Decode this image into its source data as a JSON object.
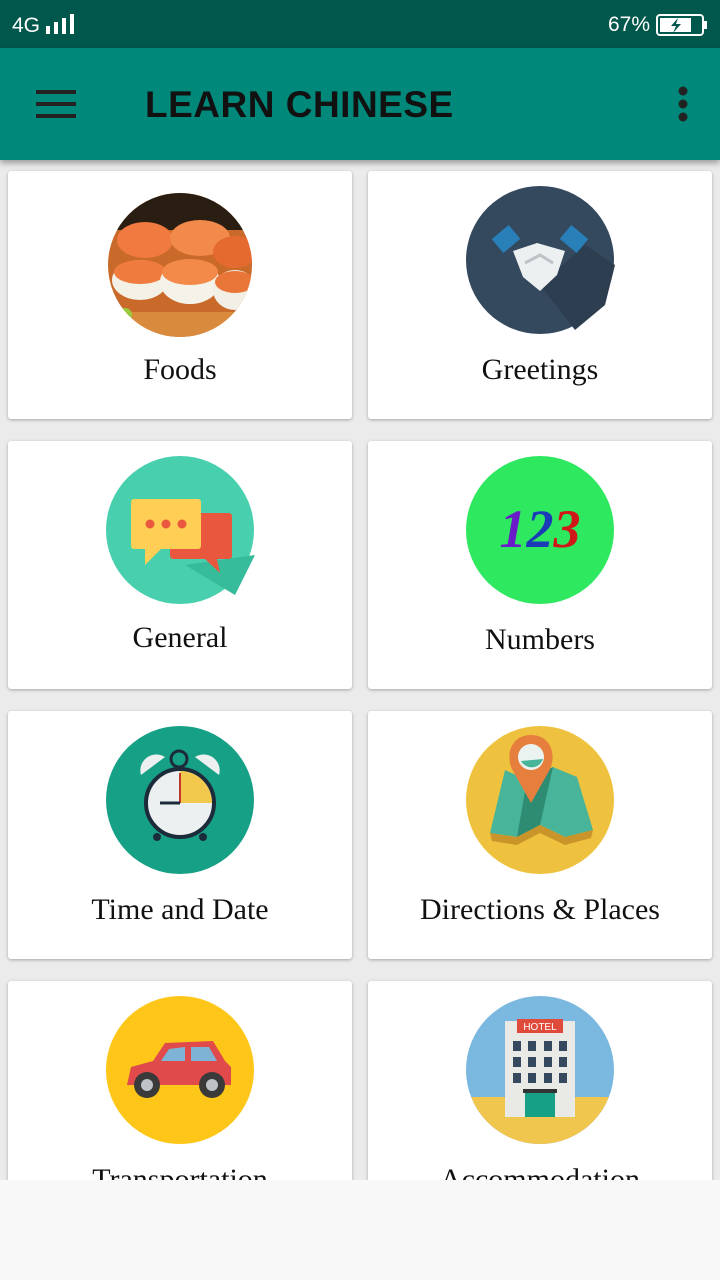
{
  "status": {
    "network": "4G",
    "battery_percent": "67%"
  },
  "appbar": {
    "title": "LEARN CHINESE"
  },
  "categories": [
    {
      "label": "Foods",
      "icon": "sushi-icon"
    },
    {
      "label": "Greetings",
      "icon": "handshake-icon"
    },
    {
      "label": "General",
      "icon": "chat-bubbles-icon"
    },
    {
      "label": "Numbers",
      "icon": "numbers-123-icon",
      "icon_text": "123"
    },
    {
      "label": "Time and Date",
      "icon": "alarm-clock-icon"
    },
    {
      "label": "Directions & Places",
      "icon": "map-pin-icon"
    },
    {
      "label": "Transportation",
      "icon": "car-icon"
    },
    {
      "label": "Accommodation",
      "icon": "hotel-icon",
      "icon_text": "HOTEL"
    }
  ],
  "colors": {
    "statusbar": "#00574b",
    "appbar": "#00897b"
  }
}
